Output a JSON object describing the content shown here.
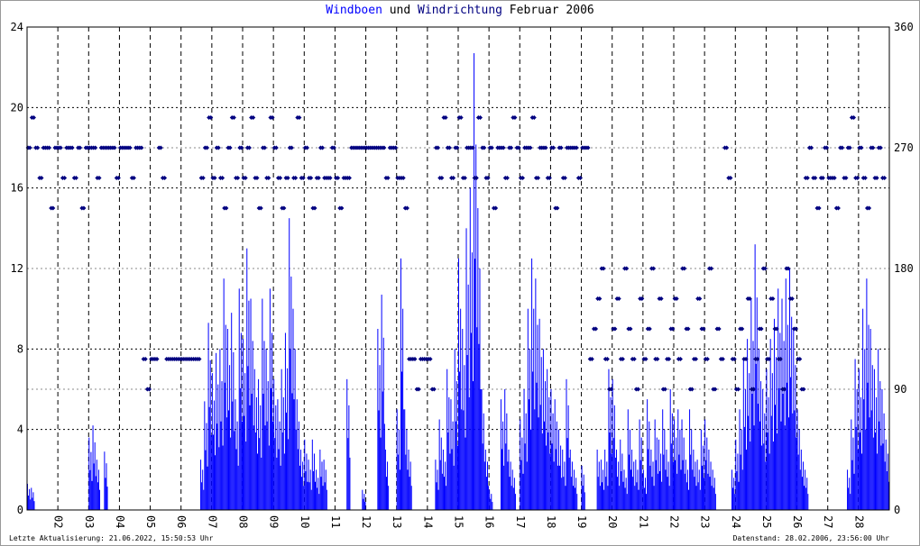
{
  "chart_data": {
    "type": "bar",
    "title": {
      "part1": "Windboen",
      "part2": "und",
      "part3": "Windrichtung",
      "part4": "Februar 2006"
    },
    "xlabel": "",
    "ylabel_left": "Windboen",
    "ylabel_right": "Windrichtung",
    "ylim_left": [
      0,
      24
    ],
    "ylim_right": [
      0,
      360
    ],
    "xlim_days": [
      0,
      28
    ],
    "left_ticks": [
      "0",
      "4",
      "8",
      "12",
      "16",
      "20",
      "24"
    ],
    "right_ticks": [
      "0",
      "90",
      "180",
      "270",
      "360"
    ],
    "x_tick_labels": [
      "02",
      "03",
      "04",
      "05",
      "06",
      "07",
      "08",
      "09",
      "10",
      "11",
      "12",
      "13",
      "14",
      "15",
      "16",
      "17",
      "18",
      "19",
      "20",
      "21",
      "22",
      "23",
      "24",
      "25",
      "26",
      "27",
      "28"
    ],
    "grid": true,
    "sample_interval_hours": 3,
    "series": [
      {
        "name": "Windboen",
        "type": "bar",
        "color": "#0000ff",
        "values": [
          1.3,
          1.1,
          0,
          0,
          0,
          0,
          0,
          0,
          0,
          0,
          0,
          0,
          0,
          0,
          0,
          0,
          3.6,
          4.2,
          2.5,
          0,
          2.9,
          0,
          0,
          0,
          0,
          0,
          0,
          0,
          0,
          0,
          0,
          0,
          0,
          0,
          0,
          0,
          0,
          0,
          0,
          0,
          0,
          0,
          0,
          0,
          0,
          2.5,
          5.4,
          9.3,
          6.8,
          7.8,
          8.0,
          11.5,
          9.0,
          9.8,
          5.5,
          11.0,
          8.5,
          13.0,
          10.5,
          7.0,
          6.5,
          10.5,
          8.0,
          11.0,
          6.5,
          5.5,
          7.0,
          8.8,
          14.5,
          10.0,
          5.5,
          3.0,
          3.5,
          2.5,
          3.5,
          2.0,
          3.0,
          2.5,
          0,
          0,
          0,
          0,
          0,
          6.5,
          0,
          0,
          0,
          1.0,
          0,
          0,
          0,
          9.0,
          10.7,
          3.0,
          0,
          0,
          5.0,
          12.5,
          5.0,
          3.0,
          0,
          0,
          0,
          0,
          0,
          0,
          2.5,
          4.5,
          3.0,
          7.0,
          5.5,
          8.0,
          12.5,
          9.0,
          14.0,
          16.0,
          22.7,
          15.0,
          6.0,
          3.0,
          1.0,
          0,
          0,
          5.5,
          6.0,
          3.0,
          2.0,
          0,
          4.5,
          6.0,
          10.0,
          12.5,
          11.5,
          9.5,
          8.0,
          7.0,
          6.0,
          5.5,
          4.0,
          3.0,
          6.5,
          3.0,
          2.0,
          0,
          2.2,
          0,
          0,
          0,
          3.0,
          2.5,
          3.0,
          7.0,
          6.5,
          3.0,
          3.5,
          2.0,
          5.0,
          3.0,
          2.5,
          4.5,
          2.0,
          5.5,
          3.0,
          4.5,
          3.5,
          5.0,
          3.0,
          6.0,
          4.5,
          5.0,
          4.5,
          2.5,
          5.0,
          3.0,
          2.5,
          4.0,
          4.5,
          3.0,
          2.0,
          0,
          0,
          0,
          0,
          2.0,
          3.5,
          5.0,
          7.5,
          8.5,
          10.5,
          13.2,
          8.0,
          6.0,
          7.0,
          8.5,
          9.5,
          11.0,
          10.5,
          11.5,
          12.0,
          9.0,
          5.0,
          3.0,
          2.0,
          0,
          0,
          0,
          0,
          0,
          0,
          0,
          0,
          0,
          0,
          2.0,
          4.5,
          7.5,
          7.0,
          10.0,
          11.5,
          9.0,
          7.0,
          8.0,
          6.0,
          3.5
        ]
      },
      {
        "name": "Windrichtung",
        "type": "scatter",
        "color": "#000080",
        "values": [
          270,
          292.5,
          270,
          247.5,
          270,
          270,
          225,
          270,
          270,
          247.5,
          270,
          270,
          247.5,
          270,
          225,
          270,
          270,
          270,
          247.5,
          270,
          270,
          270,
          270,
          247.5,
          270,
          270,
          270,
          247.5,
          270,
          270,
          112.5,
          90,
          112.5,
          112.5,
          270,
          247.5,
          112.5,
          112.5,
          112.5,
          112.5,
          112.5,
          112.5,
          112.5,
          112.5,
          112.5,
          247.5,
          270,
          292.5,
          247.5,
          270,
          247.5,
          225,
          270,
          292.5,
          247.5,
          270,
          247.5,
          270,
          292.5,
          247.5,
          225,
          270,
          247.5,
          292.5,
          270,
          247.5,
          225,
          247.5,
          270,
          247.5,
          292.5,
          247.5,
          270,
          247.5,
          225,
          247.5,
          270,
          247.5,
          247.5,
          270,
          247.5,
          225,
          247.5,
          247.5,
          270,
          270,
          270,
          270,
          270,
          270,
          270,
          270,
          270,
          247.5,
          270,
          270,
          247.5,
          247.5,
          225,
          112.5,
          112.5,
          90,
          112.5,
          112.5,
          112.5,
          90,
          270,
          247.5,
          292.5,
          270,
          247.5,
          270,
          292.5,
          247.5,
          270,
          270,
          247.5,
          292.5,
          270,
          247.5,
          270,
          225,
          270,
          270,
          247.5,
          270,
          292.5,
          270,
          247.5,
          270,
          270,
          292.5,
          247.5,
          270,
          270,
          247.5,
          270,
          225,
          270,
          247.5,
          270,
          270,
          270,
          247.5,
          270,
          270,
          112.5,
          135,
          157.5,
          180,
          112.5,
          90,
          135,
          157.5,
          112.5,
          180,
          135,
          112.5,
          90,
          157.5,
          112.5,
          135,
          180,
          112.5,
          157.5,
          90,
          112.5,
          135,
          157.5,
          112.5,
          180,
          135,
          90,
          112.5,
          157.5,
          135,
          112.5,
          180,
          90,
          135,
          112.5,
          270,
          247.5,
          112.5,
          90,
          135,
          112.5,
          157.5,
          90,
          112.5,
          135,
          180,
          112.5,
          157.5,
          135,
          112.5,
          90,
          180,
          157.5,
          135,
          112.5,
          90,
          247.5,
          270,
          247.5,
          225,
          247.5,
          270,
          247.5,
          247.5,
          225,
          270,
          247.5,
          270,
          292.5,
          247.5,
          270,
          247.5,
          225,
          270,
          247.5,
          270,
          247.5
        ]
      }
    ]
  },
  "footer": {
    "left": "Letzte Aktualisierung: 21.06.2022, 15:50:53 Uhr",
    "right": "Datenstand: 28.02.2006, 23:56:00 Uhr"
  }
}
